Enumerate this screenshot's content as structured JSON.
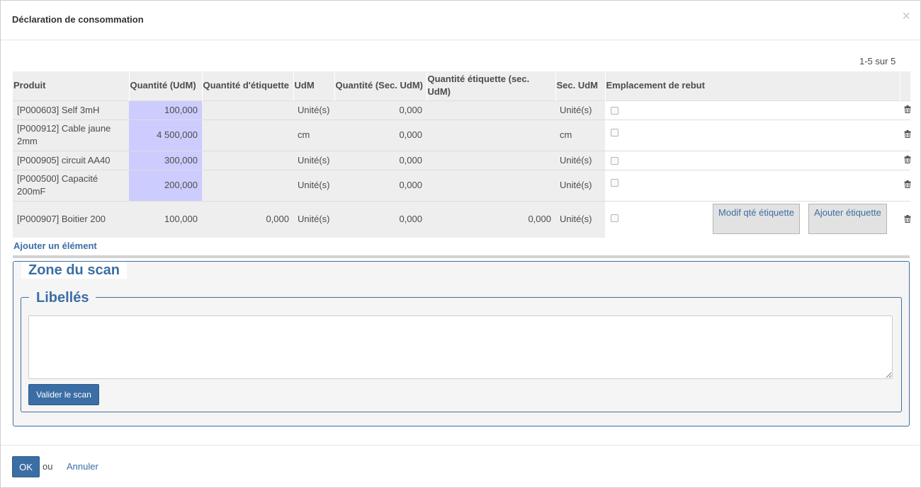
{
  "dialog": {
    "title": "Déclaration de consommation",
    "close_symbol": "×"
  },
  "pager": {
    "text": "1-5 sur 5"
  },
  "table": {
    "headers": [
      "Produit",
      "Quantité (UdM)",
      "Quantité d'étiquette",
      "UdM",
      "Quantité (Sec. UdM)",
      "Quantité étiquette (sec. UdM)",
      "Sec. UdM",
      "Emplacement de rebut"
    ],
    "rows": [
      {
        "product": "[P000603] Self 3mH",
        "qty": "100,000",
        "label_qty": "",
        "uom": "Unité(s)",
        "sec_qty": "0,000",
        "sec_label_qty": "",
        "sec_uom": "Unité(s)"
      },
      {
        "product": "[P000912] Cable jaune 2mm",
        "qty": "4 500,000",
        "label_qty": "",
        "uom": "cm",
        "sec_qty": "0,000",
        "sec_label_qty": "",
        "sec_uom": "cm"
      },
      {
        "product": "[P000905] circuit AA40",
        "qty": "300,000",
        "label_qty": "",
        "uom": "Unité(s)",
        "sec_qty": "0,000",
        "sec_label_qty": "",
        "sec_uom": "Unité(s)"
      },
      {
        "product": "[P000500] Capacité 200mF",
        "qty": "200,000",
        "label_qty": "",
        "uom": "Unité(s)",
        "sec_qty": "0,000",
        "sec_label_qty": "",
        "sec_uom": "Unité(s)"
      },
      {
        "product": "[P000907] Boitier 200",
        "qty": "100,000",
        "label_qty": "0,000",
        "uom": "Unité(s)",
        "sec_qty": "0,000",
        "sec_label_qty": "0,000",
        "sec_uom": "Unité(s)"
      }
    ],
    "row_buttons": {
      "modify": "Modif qté étiquette",
      "add": "Ajouter étiquette"
    },
    "add_item": "Ajouter un élément"
  },
  "scan_zone": {
    "legend": "Zone du scan",
    "labels_legend": "Libellés",
    "textarea_value": "",
    "validate_button": "Valider le scan"
  },
  "footer": {
    "ok": "OK",
    "or": "ou",
    "cancel": "Annuler"
  },
  "icons": {
    "delete": "trash-icon",
    "close": "close-icon"
  },
  "colors": {
    "accent": "#3b6ea5",
    "highlight": "#ccccff",
    "header_bg": "#eeeeee"
  }
}
